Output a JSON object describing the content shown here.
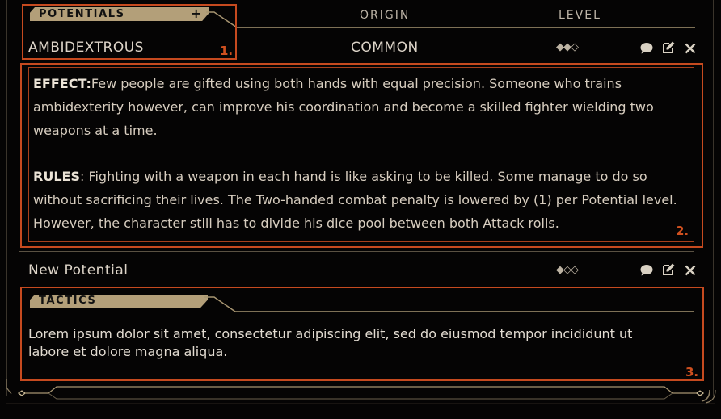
{
  "header": {
    "section_title": "POTENTIALS",
    "add_label": "+",
    "col_origin": "ORIGIN",
    "col_level": "LEVEL"
  },
  "potential1": {
    "name": "AMBIDEXTROUS",
    "origin": "COMMON",
    "level_display": "◆◆◇",
    "effect_label": "EFFECT:",
    "effect_text": "Few people are gifted using both hands with equal precision. Someone who trains ambidexterity however, can improve his coordination and become a skilled fighter wielding two weapons at a time.",
    "rules_label": "RULES",
    "rules_text": ": Fighting with a weapon in each hand is like asking to be killed. Some manage to do so without sacrificing their lives. The Two-handed combat penalty is lowered by (1) per Potential level. However, the character still has to divide his dice pool between both Attack rolls."
  },
  "potential2": {
    "name": "New Potential",
    "level_display": "◆◇◇"
  },
  "tactics": {
    "title": "TACTICS",
    "text": "Lorem ipsum dolor sit amet, consectetur adipiscing elit, sed do eiusmod tempor incididunt ut labore et dolore magna aliqua."
  },
  "annotations": [
    "1.",
    "2.",
    "3."
  ],
  "colors": {
    "accent_gold": "#b39f79",
    "annotation": "#c64a1f",
    "background": "#050404"
  },
  "icons": [
    "comment-icon",
    "edit-icon",
    "close-icon"
  ]
}
